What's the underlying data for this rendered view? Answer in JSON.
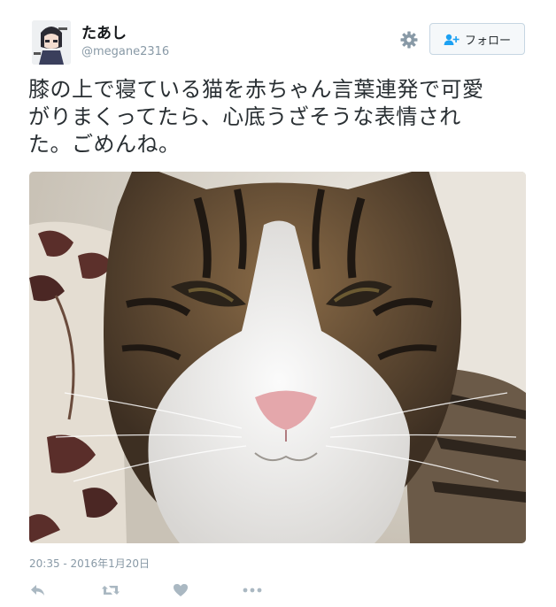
{
  "author": {
    "display_name": "たあし",
    "handle": "@megane2316",
    "avatar_icon": "user-avatar"
  },
  "header": {
    "gear_icon": "gear-icon",
    "follow_label": "フォロー",
    "follow_icon": "add-user-icon"
  },
  "tweet": {
    "text_line1": "膝の上で寝ている猫を赤ちゃん言葉連発で可愛",
    "text_line2": "がりまくってたら、心底うざそうな表情され",
    "text_line3": "た。ごめんね。",
    "timestamp": "20:35 - 2016年1月20日"
  },
  "actions": {
    "reply_icon": "reply-icon",
    "retweet_icon": "retweet-icon",
    "like_icon": "heart-icon",
    "more_icon": "more-icon"
  },
  "colors": {
    "text": "#292f33",
    "muted": "#8899a6",
    "action": "#aab8c2",
    "button_border": "#c6d6e2"
  }
}
